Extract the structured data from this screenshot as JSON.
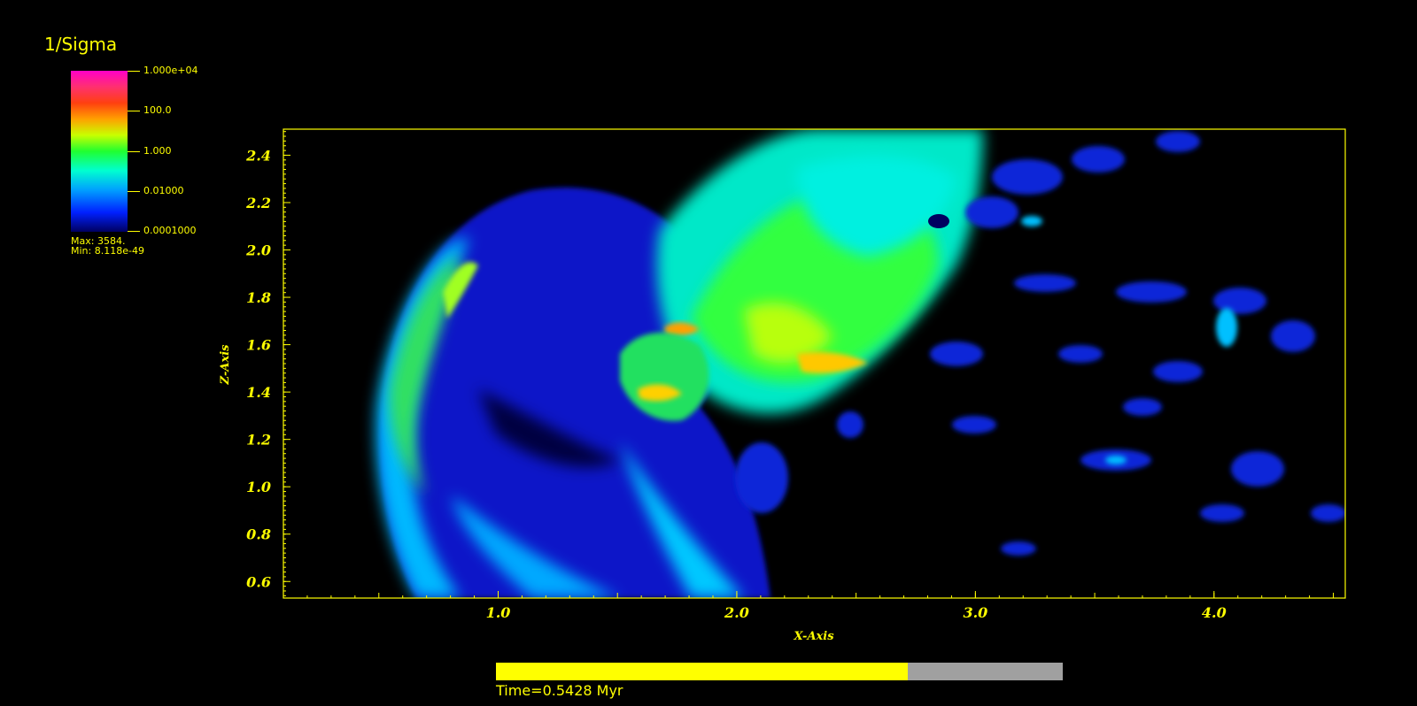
{
  "title": "1/Sigma",
  "legend": {
    "ticks": [
      "1.000e+04",
      "100.0",
      "1.000",
      "0.01000",
      "0.0001000"
    ],
    "max_label": "Max:  3584.",
    "min_label": "Min:  8.118e-49"
  },
  "chart_data": {
    "type": "heatmap",
    "xlabel": "X-Axis",
    "ylabel": "Z-Axis",
    "xlim": [
      0.1,
      4.55
    ],
    "ylim": [
      0.53,
      2.51
    ],
    "x_ticks": [
      "1.0",
      "2.0",
      "3.0",
      "4.0"
    ],
    "y_ticks": [
      "0.6",
      "0.8",
      "1.0",
      "1.2",
      "1.4",
      "1.6",
      "1.8",
      "2.0",
      "2.2",
      "2.4"
    ],
    "colorbar_scale": "log",
    "colorbar_range": [
      0.0001,
      10000
    ]
  },
  "time": {
    "label": "Time=0.5428 Myr",
    "progress": 0.727
  },
  "colors": {
    "axis": "#ffff00",
    "background": "#000000"
  }
}
